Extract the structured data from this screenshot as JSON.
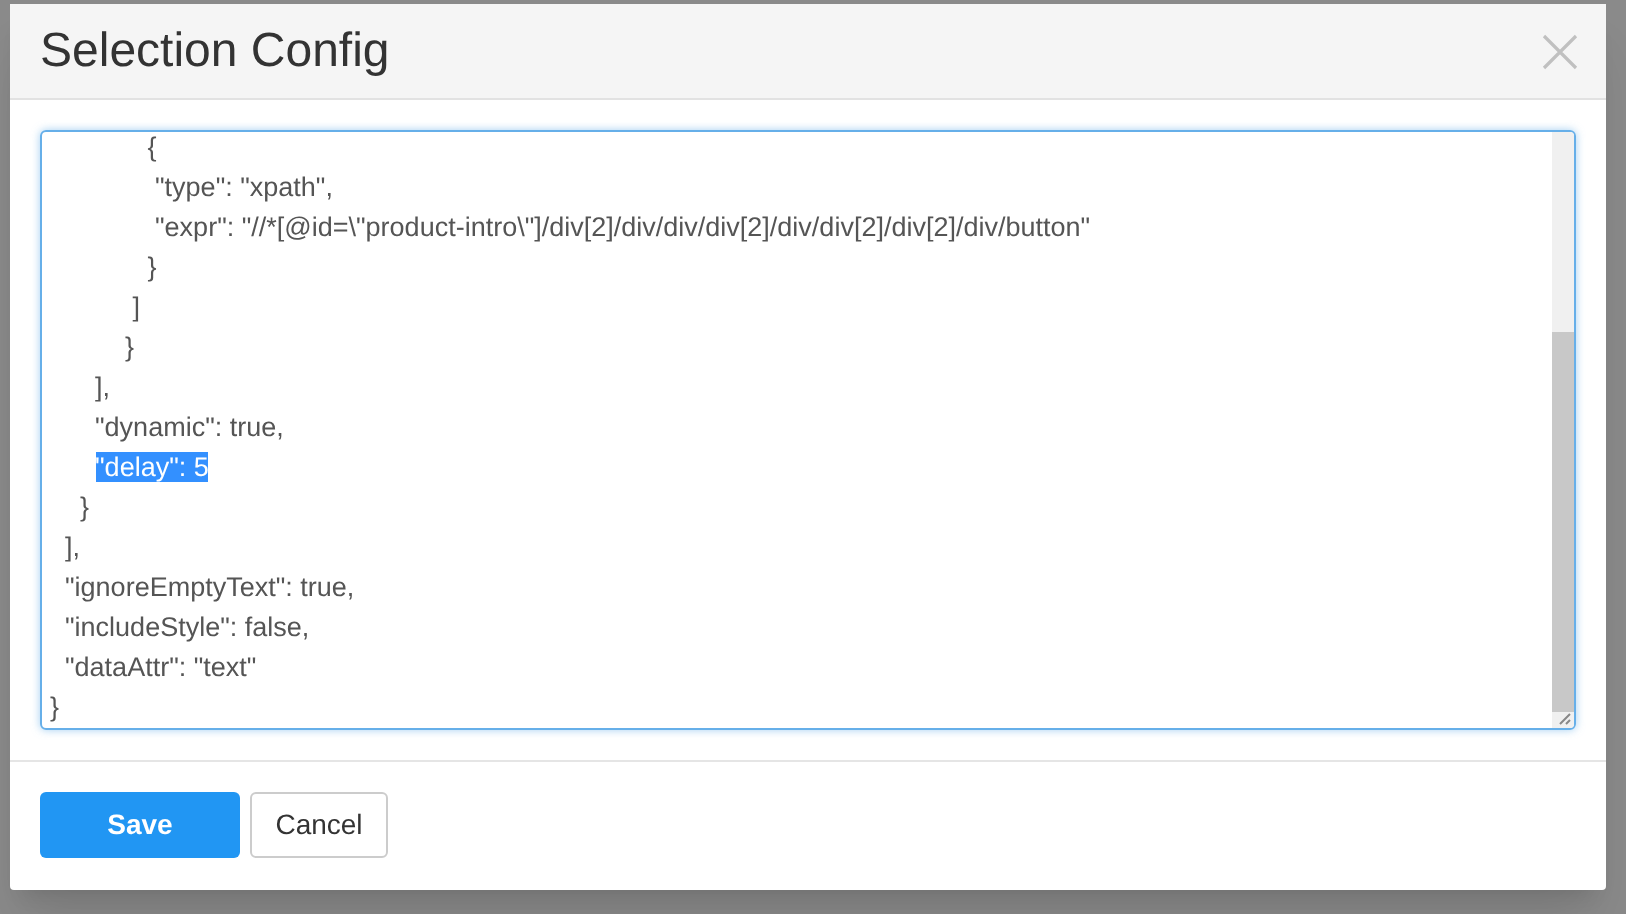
{
  "dialog": {
    "title": "Selection Config",
    "editor": {
      "lines": [
        {
          "text": "             {",
          "selected": false
        },
        {
          "text": "              \"type\": \"xpath\",",
          "selected": false
        },
        {
          "text": "              \"expr\": \"//*[@id=\\\"product-intro\\\"]/div[2]/div/div/div[2]/div/div[2]/div[2]/div/button\"",
          "selected": false
        },
        {
          "text": "             }",
          "selected": false
        },
        {
          "text": "           ]",
          "selected": false
        },
        {
          "text": "          }",
          "selected": false
        },
        {
          "text": "      ],",
          "selected": false
        },
        {
          "text": "      \"dynamic\": true,",
          "selected": false
        },
        {
          "text": "      \"delay\": 5",
          "selected": true
        },
        {
          "text": "    }",
          "selected": false
        },
        {
          "text": "  ],",
          "selected": false
        },
        {
          "text": "  \"ignoreEmptyText\": true,",
          "selected": false
        },
        {
          "text": "  \"includeStyle\": false,",
          "selected": false
        },
        {
          "text": "  \"dataAttr\": \"text\"",
          "selected": false
        },
        {
          "text": "}",
          "selected": false
        }
      ]
    },
    "buttons": [
      {
        "label": "Save",
        "kind": "primary"
      },
      {
        "label": "Cancel",
        "kind": "default"
      }
    ]
  }
}
